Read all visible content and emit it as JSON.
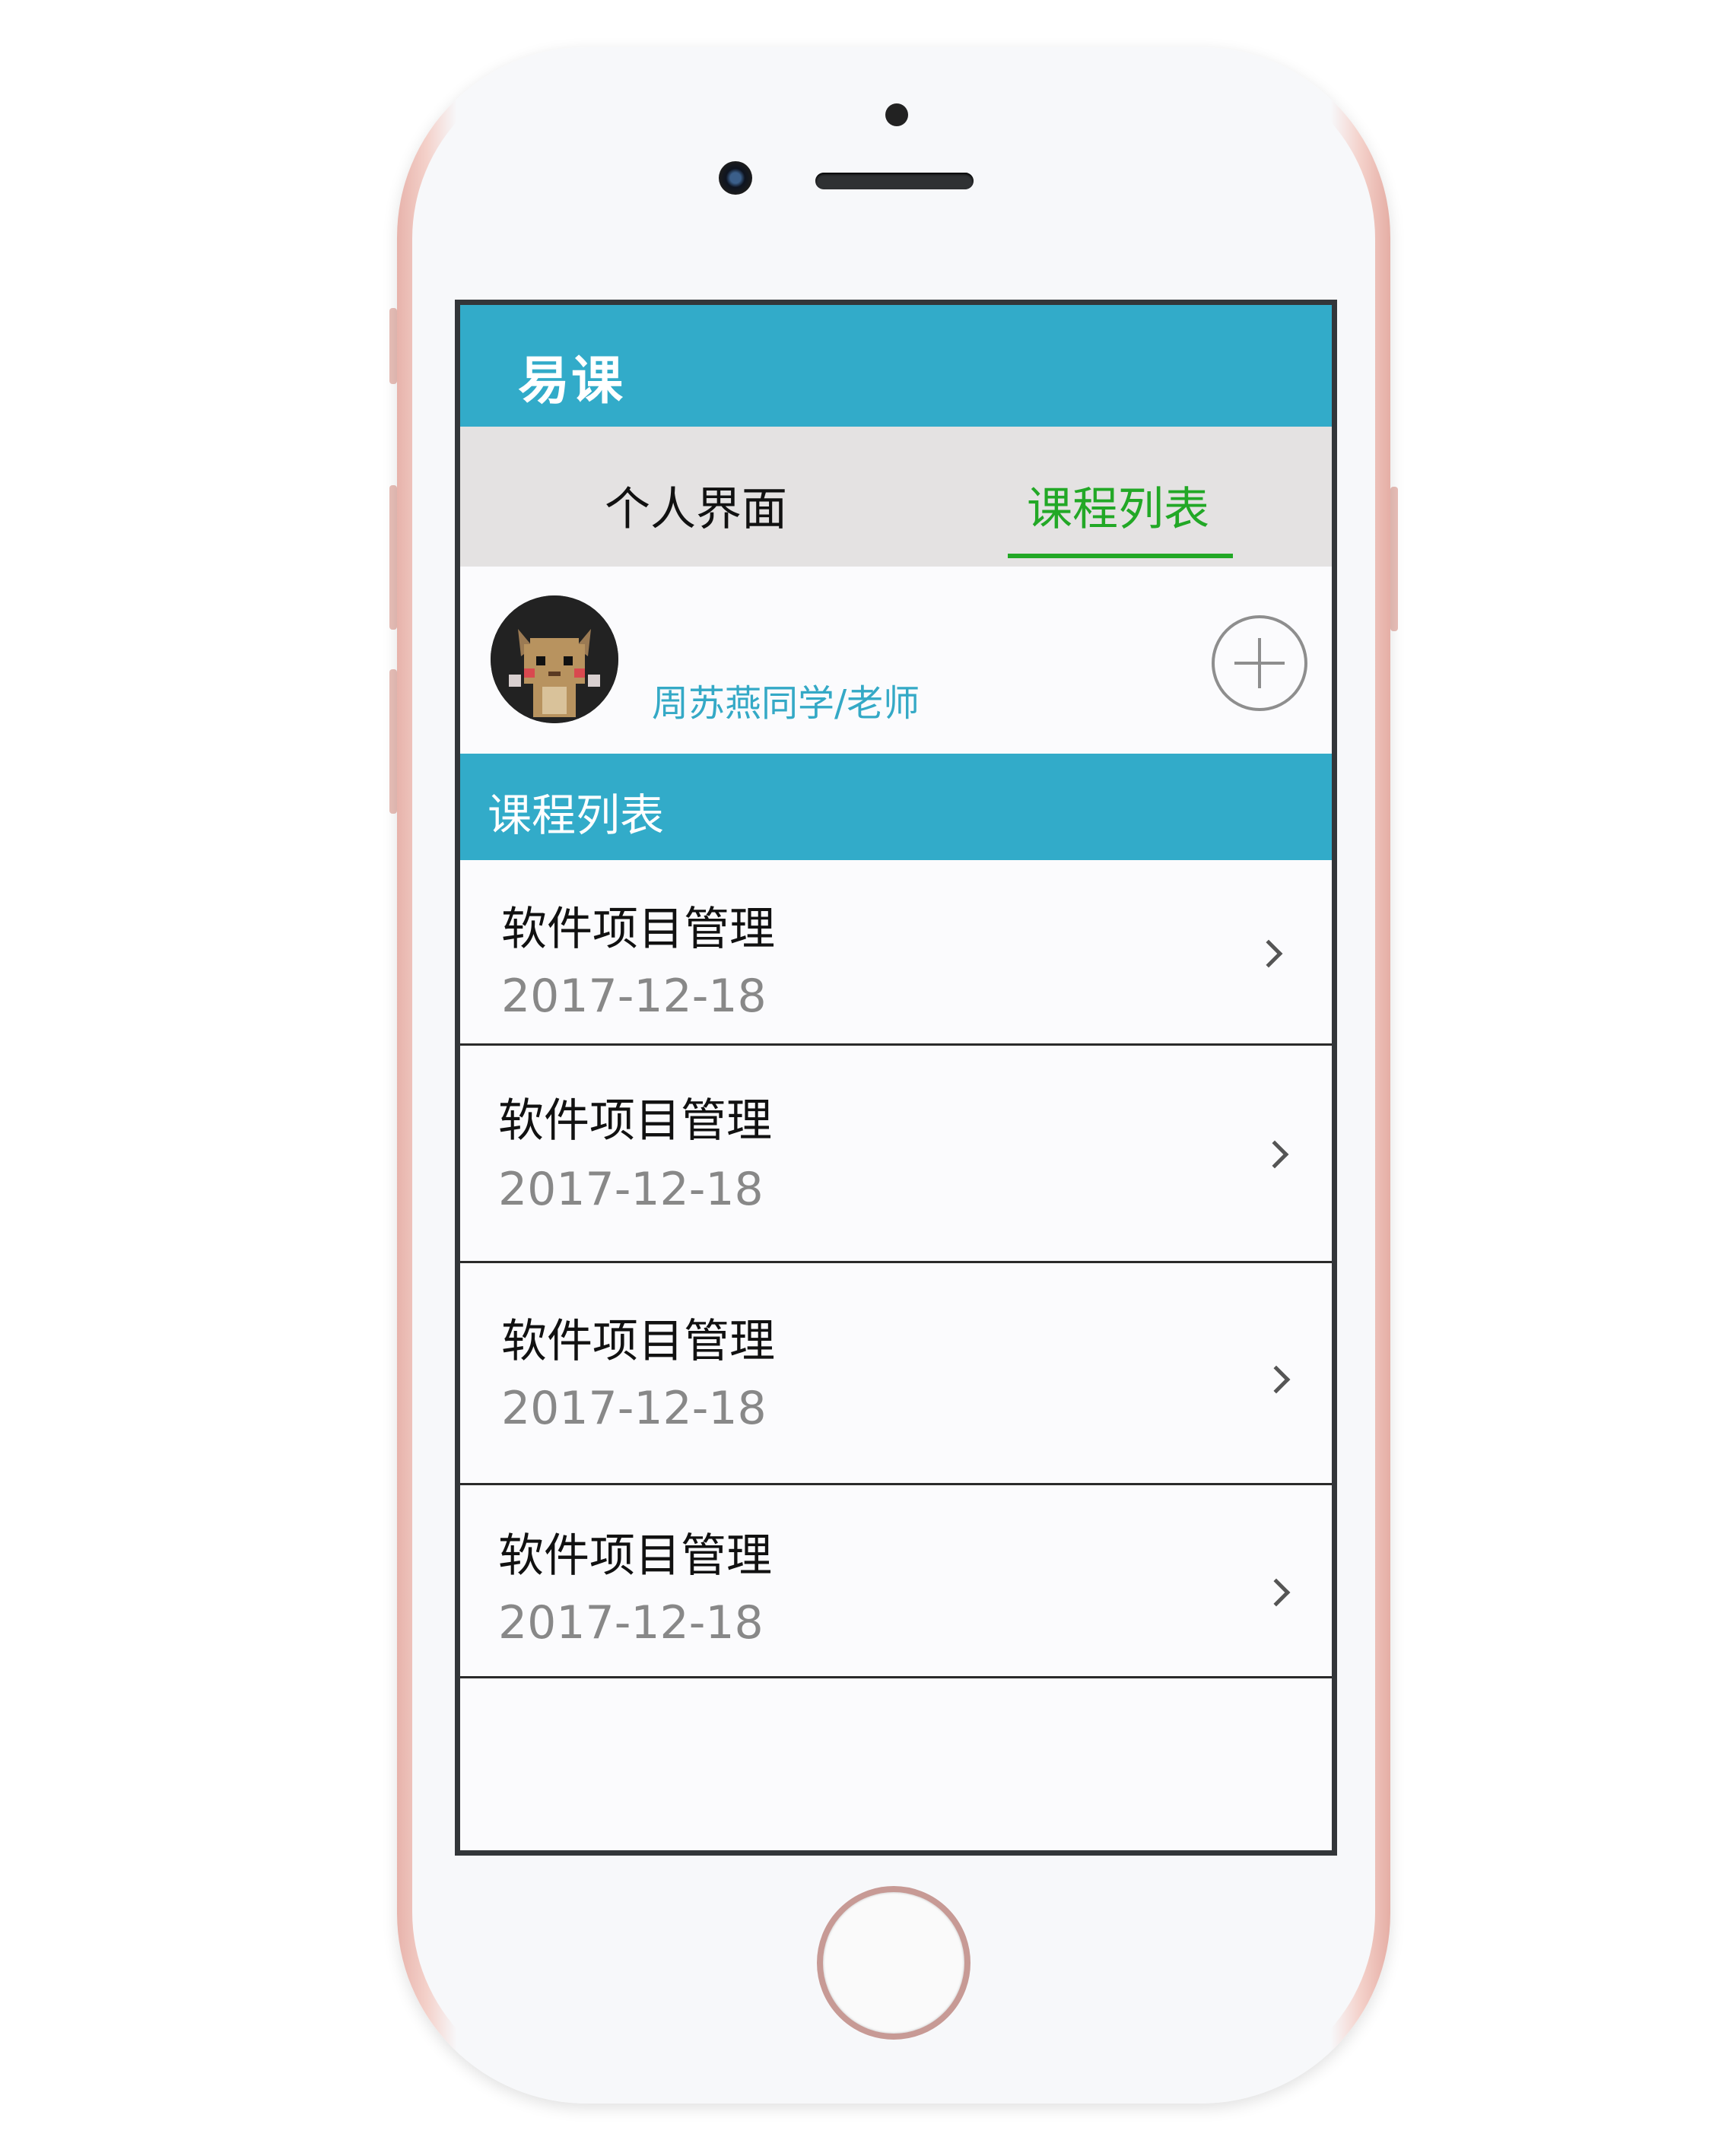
{
  "app": {
    "title": "易课"
  },
  "tabs": {
    "personal": "个人界面",
    "courses": "课程列表",
    "active": "courses"
  },
  "profile": {
    "name": "周苏燕同学/老师"
  },
  "section": {
    "title": "课程列表"
  },
  "courses": [
    {
      "name": "软件项目管理",
      "date": "2017-12-18"
    },
    {
      "name": "软件项目管理",
      "date": "2017-12-18"
    },
    {
      "name": "软件项目管理",
      "date": "2017-12-18"
    },
    {
      "name": "软件项目管理",
      "date": "2017-12-18"
    }
  ],
  "colors": {
    "accent": "#32abc9",
    "active_tab": "#22a826",
    "tab_bar": "#e4e2e2",
    "phone_frame": "#f4d1ca"
  },
  "icons": {
    "add": "plus-circle-icon",
    "row_arrow": "chevron-right-icon",
    "avatar": "pixel-character-avatar"
  }
}
